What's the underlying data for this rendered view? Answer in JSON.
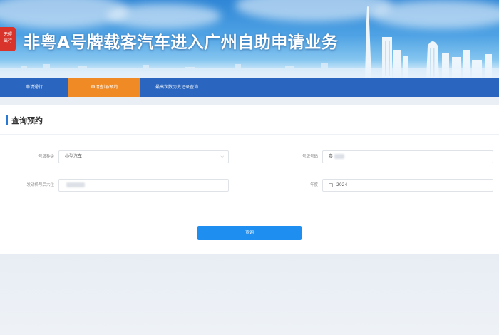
{
  "banner": {
    "logo_text": "无碍\n出行",
    "title": "非粤A号牌载客汽车进入广州自助申请业务"
  },
  "nav": {
    "items": [
      {
        "label": "申请通行",
        "active": false
      },
      {
        "label": "申请查询/预约",
        "active": true
      },
      {
        "label": "最高次数历史记录查询",
        "active": false
      }
    ]
  },
  "panel": {
    "title": "查询预约"
  },
  "form": {
    "plate_type_label": "号牌种类",
    "plate_type_value": "小型汽车",
    "plate_number_label": "号牌号码",
    "plate_number_value": "粤",
    "engine_label": "发动机号后六位",
    "year_label": "年度",
    "year_value": "2024",
    "query_button": "查询"
  },
  "colors": {
    "nav_bg": "#2a66bf",
    "nav_active": "#f08a24",
    "button": "#1e8ef0"
  }
}
